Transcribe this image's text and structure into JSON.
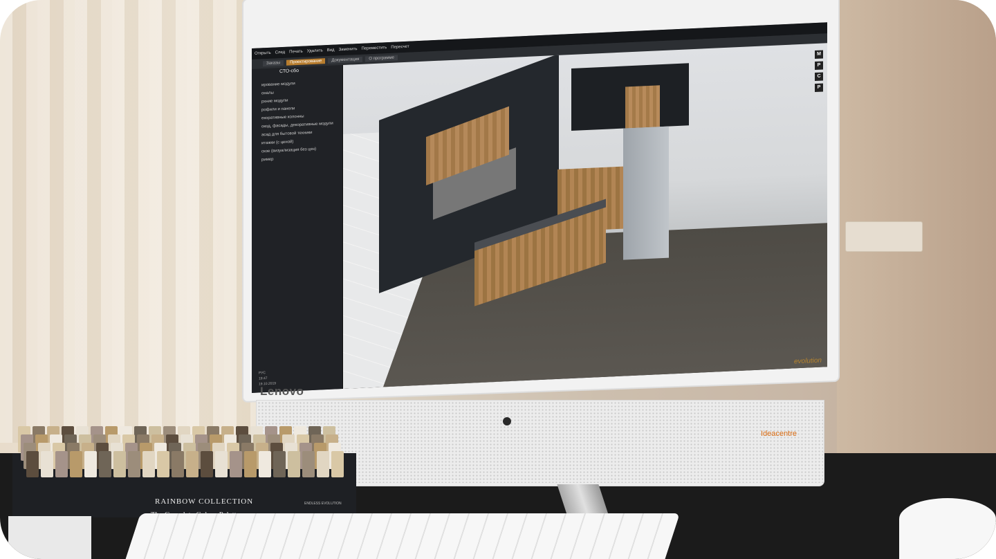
{
  "monitor": {
    "brand": "Lenovo",
    "model_label": "Ideacentre"
  },
  "app": {
    "tabs": [
      "Заказы",
      "Проектирование",
      "Документация",
      "О программе"
    ],
    "active_tab": 1,
    "sidebar_title": "СТО-сбо",
    "sidebar_items": [
      "ирование модули",
      "оналы",
      "рхние модули",
      "рофили и панели",
      "екоративные колонны",
      "окод, фасады, декоративные модули",
      "асад для бытовой техники",
      "итажки (с ценой)",
      "ское (визуализация без цен)",
      "ример"
    ],
    "sidebar_foot": [
      "РУС",
      "19:47",
      "19.10.2019"
    ],
    "toolbar": [
      "Открыть",
      "След",
      "Печать",
      "Удалить",
      "Вид",
      "Заменить",
      "Переместить",
      "Пересчет"
    ],
    "watermark": "evolution",
    "tools": [
      "M",
      "P",
      "C",
      "P"
    ]
  },
  "samples": {
    "title": "RAINBOW COLLECTION",
    "subtitle": "The Complete Colour Palette",
    "brand": "ENDLESS EVOLUTION"
  },
  "colors": {
    "accent_tab": "#b87d2e",
    "app_bg": "#202226",
    "brand_orange": "#d86a10"
  }
}
